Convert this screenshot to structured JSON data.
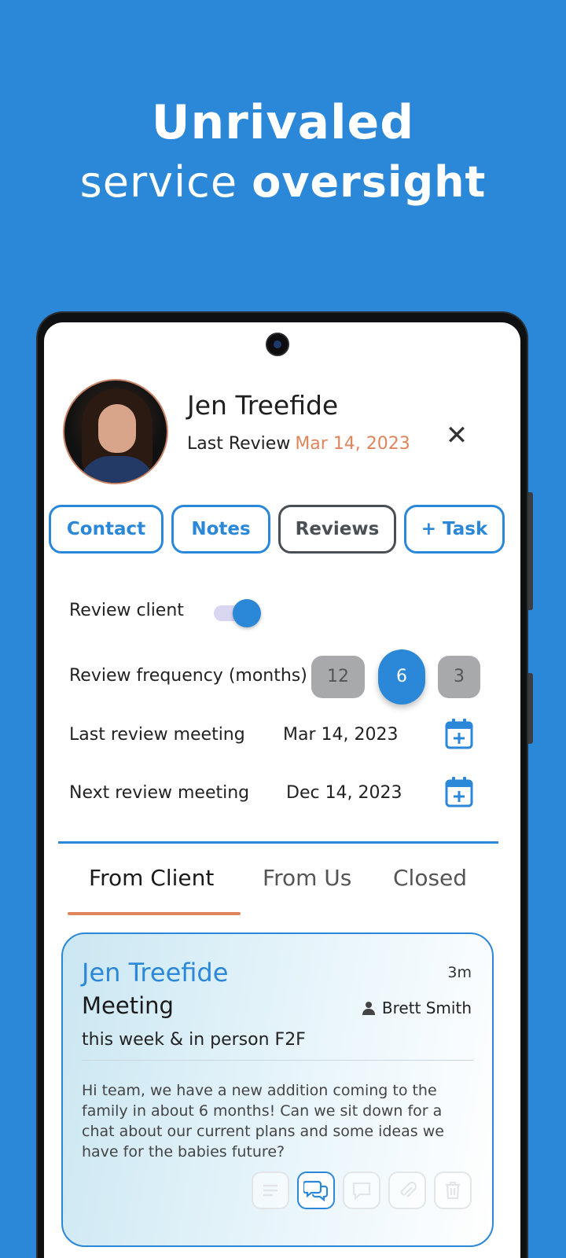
{
  "headline": {
    "line1": "Unrivaled",
    "line2_regular": "service",
    "line2_bold": "oversight"
  },
  "profile": {
    "name": "Jen Treefide",
    "last_review_label": "Last Review",
    "last_review_date": "Mar 14, 2023",
    "close_icon": "close-icon"
  },
  "tab_buttons": [
    {
      "label": "Contact",
      "active": false
    },
    {
      "label": "Notes",
      "active": false
    },
    {
      "label": "Reviews",
      "active": true
    },
    {
      "label": "+ Task",
      "active": false
    }
  ],
  "review": {
    "review_client_label": "Review client",
    "review_client_enabled": true,
    "frequency_label": "Review frequency (months)",
    "frequency_options": [
      "12",
      "6",
      "3"
    ],
    "frequency_selected": "6",
    "last_meeting_label": "Last review meeting",
    "last_meeting_date": "Mar 14, 2023",
    "next_meeting_label": "Next review meeting",
    "next_meeting_date": "Dec 14, 2023"
  },
  "segments": [
    {
      "label": "From Client",
      "active": true
    },
    {
      "label": "From Us",
      "active": false
    },
    {
      "label": "Closed",
      "active": false
    }
  ],
  "card": {
    "name": "Jen Treefide",
    "time": "3m",
    "type": "Meeting",
    "assignee": "Brett Smith",
    "subtitle": "this week & in person F2F",
    "message": "Hi team, we have a new addition coming to the family in about 6 months! Can we sit down for a chat about our current plans and some ideas we have for the babies future?",
    "actions": [
      "notes-icon",
      "chat-icon",
      "comment-icon",
      "attach-icon",
      "trash-icon"
    ],
    "active_action": "chat-icon"
  },
  "colors": {
    "brand_blue": "#2b87d8",
    "accent_orange": "#e0845c",
    "inactive_gray": "#a8a9ab"
  }
}
